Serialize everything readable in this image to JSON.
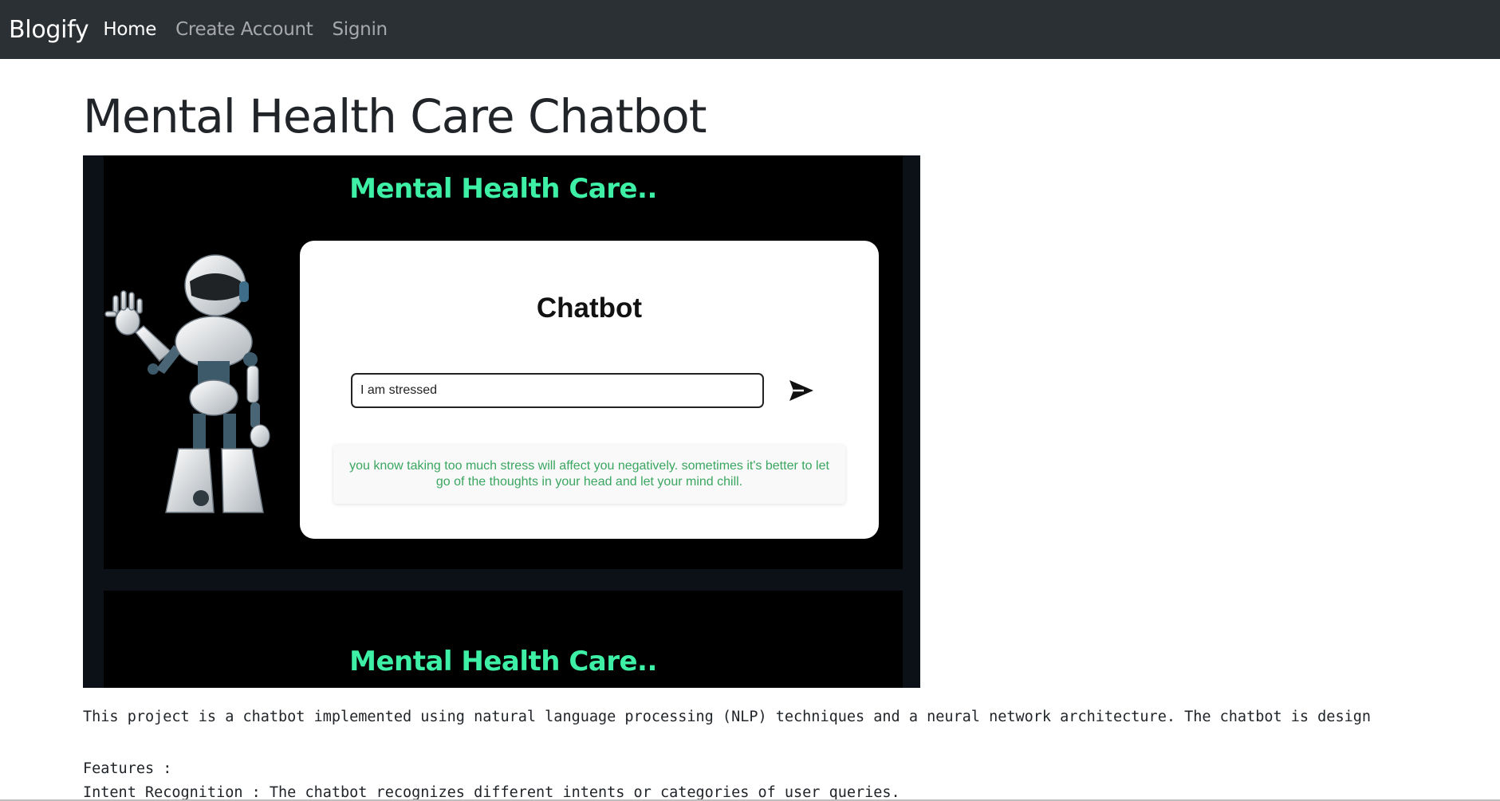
{
  "navbar": {
    "brand": "Blogify",
    "links": [
      {
        "label": "Home",
        "active": true
      },
      {
        "label": "Create Account",
        "active": false
      },
      {
        "label": "Signin",
        "active": false
      }
    ]
  },
  "page": {
    "title": "Mental Health Care Chatbot"
  },
  "hero_image": {
    "banner_text": "Mental Health Care..",
    "banner_text_repeat": "Mental Health Care..",
    "chat": {
      "heading": "Chatbot",
      "input_value": "I am stressed",
      "send_icon": "send-arrow-icon",
      "response": "you know taking too much stress will affect you negatively. sometimes it's better to let go of the thoughts in your head and let your mind chill."
    },
    "colors": {
      "banner_text": "#3ef0a5",
      "response_text": "#3aa660",
      "background": "#000000"
    }
  },
  "description": {
    "intro": "This project is a chatbot implemented using natural language processing (NLP) techniques and a neural network architecture. The chatbot is design",
    "features_label": "Features :",
    "feature_1": "Intent Recognition : The chatbot recognizes different intents or categories of user queries."
  }
}
